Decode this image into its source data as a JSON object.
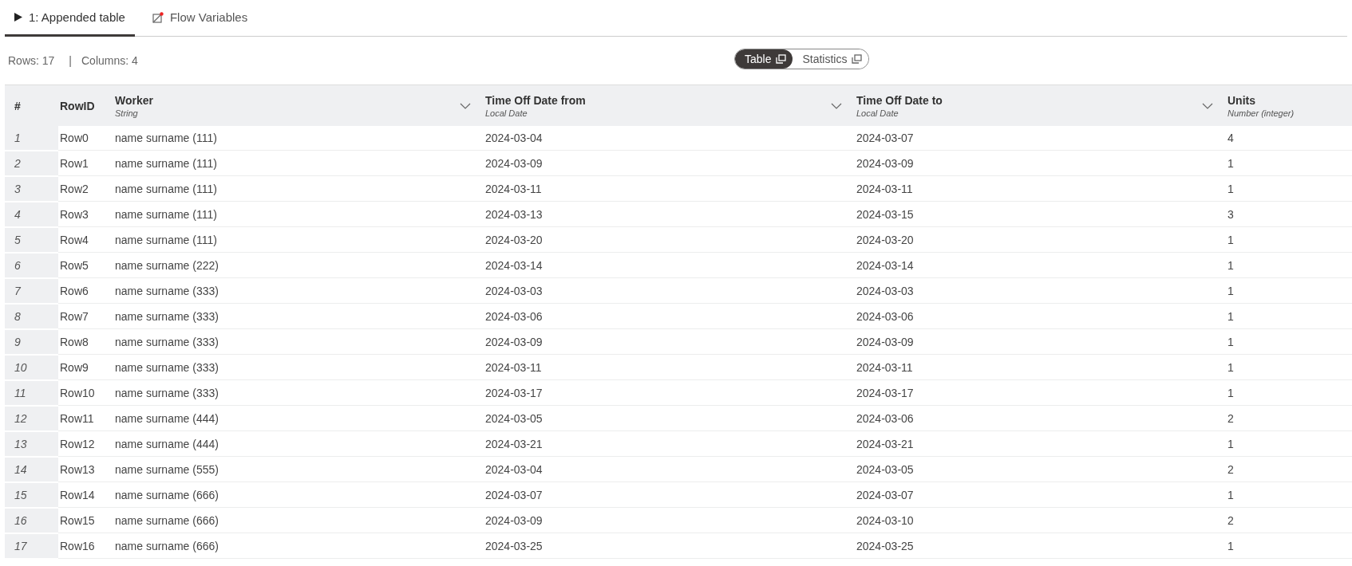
{
  "tabs": [
    {
      "label": "1: Appended table",
      "selected": true,
      "kind": "play"
    },
    {
      "label": "Flow Variables",
      "selected": false,
      "kind": "flow"
    }
  ],
  "summary": {
    "rows": "Rows: 17",
    "separator": "|",
    "columns": "Columns: 4"
  },
  "view_toggle": [
    {
      "label": "Table",
      "selected": true
    },
    {
      "label": "Statistics",
      "selected": false
    }
  ],
  "table": {
    "index_header": "#",
    "rowid_header": "RowID",
    "columns": [
      {
        "name": "Worker",
        "type": "String"
      },
      {
        "name": "Time Off Date from",
        "type": "Local Date"
      },
      {
        "name": "Time Off Date to",
        "type": "Local Date"
      },
      {
        "name": "Units",
        "type": "Number (integer)"
      }
    ],
    "rows": [
      {
        "index": "1",
        "rowid": "Row0",
        "cells": [
          "name surname (111)",
          "2024-03-04",
          "2024-03-07",
          "4"
        ]
      },
      {
        "index": "2",
        "rowid": "Row1",
        "cells": [
          "name surname (111)",
          "2024-03-09",
          "2024-03-09",
          "1"
        ]
      },
      {
        "index": "3",
        "rowid": "Row2",
        "cells": [
          "name surname (111)",
          "2024-03-11",
          "2024-03-11",
          "1"
        ]
      },
      {
        "index": "4",
        "rowid": "Row3",
        "cells": [
          "name surname (111)",
          "2024-03-13",
          "2024-03-15",
          "3"
        ]
      },
      {
        "index": "5",
        "rowid": "Row4",
        "cells": [
          "name surname (111)",
          "2024-03-20",
          "2024-03-20",
          "1"
        ]
      },
      {
        "index": "6",
        "rowid": "Row5",
        "cells": [
          "name surname (222)",
          "2024-03-14",
          "2024-03-14",
          "1"
        ]
      },
      {
        "index": "7",
        "rowid": "Row6",
        "cells": [
          "name surname (333)",
          "2024-03-03",
          "2024-03-03",
          "1"
        ]
      },
      {
        "index": "8",
        "rowid": "Row7",
        "cells": [
          "name surname (333)",
          "2024-03-06",
          "2024-03-06",
          "1"
        ]
      },
      {
        "index": "9",
        "rowid": "Row8",
        "cells": [
          "name surname (333)",
          "2024-03-09",
          "2024-03-09",
          "1"
        ]
      },
      {
        "index": "10",
        "rowid": "Row9",
        "cells": [
          "name surname (333)",
          "2024-03-11",
          "2024-03-11",
          "1"
        ]
      },
      {
        "index": "11",
        "rowid": "Row10",
        "cells": [
          "name surname (333)",
          "2024-03-17",
          "2024-03-17",
          "1"
        ]
      },
      {
        "index": "12",
        "rowid": "Row11",
        "cells": [
          "name surname (444)",
          "2024-03-05",
          "2024-03-06",
          "2"
        ]
      },
      {
        "index": "13",
        "rowid": "Row12",
        "cells": [
          "name surname (444)",
          "2024-03-21",
          "2024-03-21",
          "1"
        ]
      },
      {
        "index": "14",
        "rowid": "Row13",
        "cells": [
          "name surname (555)",
          "2024-03-04",
          "2024-03-05",
          "2"
        ]
      },
      {
        "index": "15",
        "rowid": "Row14",
        "cells": [
          "name surname (666)",
          "2024-03-07",
          "2024-03-07",
          "1"
        ]
      },
      {
        "index": "16",
        "rowid": "Row15",
        "cells": [
          "name surname (666)",
          "2024-03-09",
          "2024-03-10",
          "2"
        ]
      },
      {
        "index": "17",
        "rowid": "Row16",
        "cells": [
          "name surname (666)",
          "2024-03-25",
          "2024-03-25",
          "1"
        ]
      }
    ]
  }
}
